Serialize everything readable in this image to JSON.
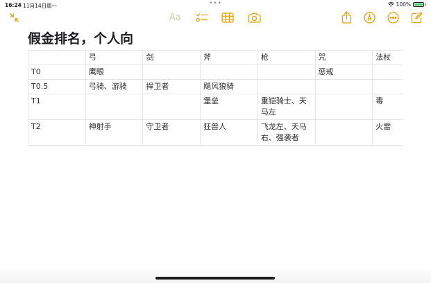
{
  "status_bar": {
    "time": "16:24",
    "date": "11月14日周一",
    "battery": "100%"
  },
  "toolbar": {
    "format_label": "Aa",
    "accent_color": "#e5a100",
    "icons": [
      "collapse-icon",
      "checklist-icon",
      "table-icon",
      "camera-icon",
      "share-icon",
      "markup-icon",
      "more-icon",
      "compose-icon"
    ]
  },
  "note": {
    "title": "假金排名，个人向"
  },
  "table": {
    "header": [
      "",
      "弓",
      "剑",
      "斧",
      "枪",
      "咒",
      "法杖"
    ],
    "rows": [
      [
        "T0",
        "鹰眼",
        "",
        "",
        "",
        "惩戒",
        ""
      ],
      [
        "T0.5",
        "弓骑、游骑",
        "捍卫者",
        "飓风狼骑",
        "",
        "",
        ""
      ],
      [
        "T1",
        "",
        "",
        "堡垒",
        "重铠骑士、天马左",
        "",
        "毒"
      ],
      [
        "T2",
        "神射手",
        "守卫者",
        "狂兽人",
        "飞龙左、天马右、强袭者",
        "",
        "火雷"
      ]
    ]
  }
}
